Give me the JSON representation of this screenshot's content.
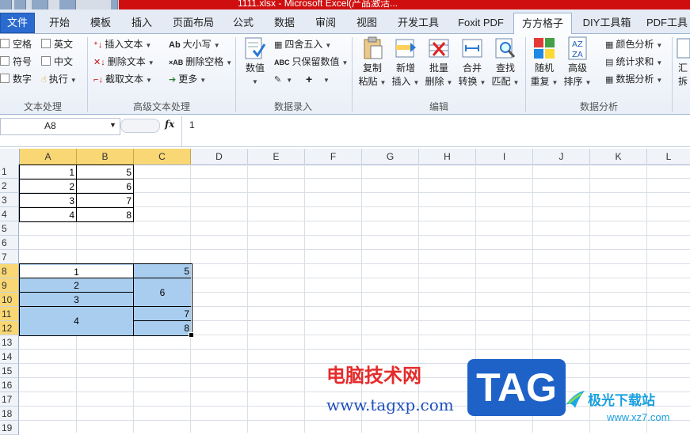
{
  "titlebar": {
    "text": "1111.xlsx - Microsoft Excel(产品激活..."
  },
  "tabs": [
    "文件",
    "开始",
    "模板",
    "插入",
    "页面布局",
    "公式",
    "数据",
    "审阅",
    "视图",
    "开发工具",
    "Foxit PDF",
    "方方格子",
    "DIY工具箱",
    "PDF工具"
  ],
  "ribbon": {
    "text_group": {
      "label": "文本处理",
      "items": [
        "空格",
        "英文",
        "符号",
        "中文",
        "数字",
        "执行"
      ]
    },
    "adv_group": {
      "label": "高级文本处理",
      "items": [
        "插入文本",
        "删除文本",
        "截取文本",
        "大小写",
        "删除空格",
        "更多"
      ]
    },
    "entry_group": {
      "label": "数据录入",
      "big": "数值",
      "items": [
        "四舍五入",
        "只保留数值"
      ]
    },
    "edit_group": {
      "label": "编辑",
      "buttons": [
        {
          "l1": "复制",
          "l2": "粘贴"
        },
        {
          "l1": "新增",
          "l2": "插入"
        },
        {
          "l1": "批量",
          "l2": "删除"
        },
        {
          "l1": "合并",
          "l2": "转换"
        },
        {
          "l1": "查找",
          "l2": "匹配"
        }
      ]
    },
    "analysis_group": {
      "label": "数据分析",
      "buttons": [
        {
          "l1": "随机",
          "l2": "重复"
        },
        {
          "l1": "高级",
          "l2": "排序"
        }
      ],
      "items": [
        "颜色分析",
        "统计求和",
        "数据分析"
      ]
    },
    "cut_group": {
      "l1": "汇",
      "l2": "拆"
    }
  },
  "formula_bar": {
    "name_box": "A8",
    "fx": "fx",
    "value": "1"
  },
  "columns": [
    "A",
    "B",
    "C",
    "D",
    "E",
    "F",
    "G",
    "H",
    "I",
    "J",
    "K",
    "L"
  ],
  "rows": [
    "1",
    "2",
    "3",
    "4",
    "5",
    "6",
    "7",
    "8",
    "9",
    "10",
    "11",
    "12",
    "13",
    "14",
    "15",
    "16",
    "17",
    "18",
    "19"
  ],
  "cells": {
    "a1": "1",
    "b1": "5",
    "a2": "2",
    "b2": "6",
    "a3": "3",
    "b3": "7",
    "a4": "4",
    "b4": "8",
    "a8": "1",
    "c8": "5",
    "a9": "2",
    "c9_10": "6",
    "a10": "3",
    "a11_12": "4",
    "c11": "7",
    "c12": "8"
  },
  "watermark": {
    "cn": "电脑技术网",
    "url": "www.tagxp.com",
    "tag": "TAG",
    "site_cn": "极光下载站",
    "site_url": "www.xz7.com"
  },
  "colors": {
    "accent": "#2b6bd0",
    "selection": "#a9cdef",
    "header_sel": "#f8d774",
    "title_red": "#cf0f0f"
  }
}
